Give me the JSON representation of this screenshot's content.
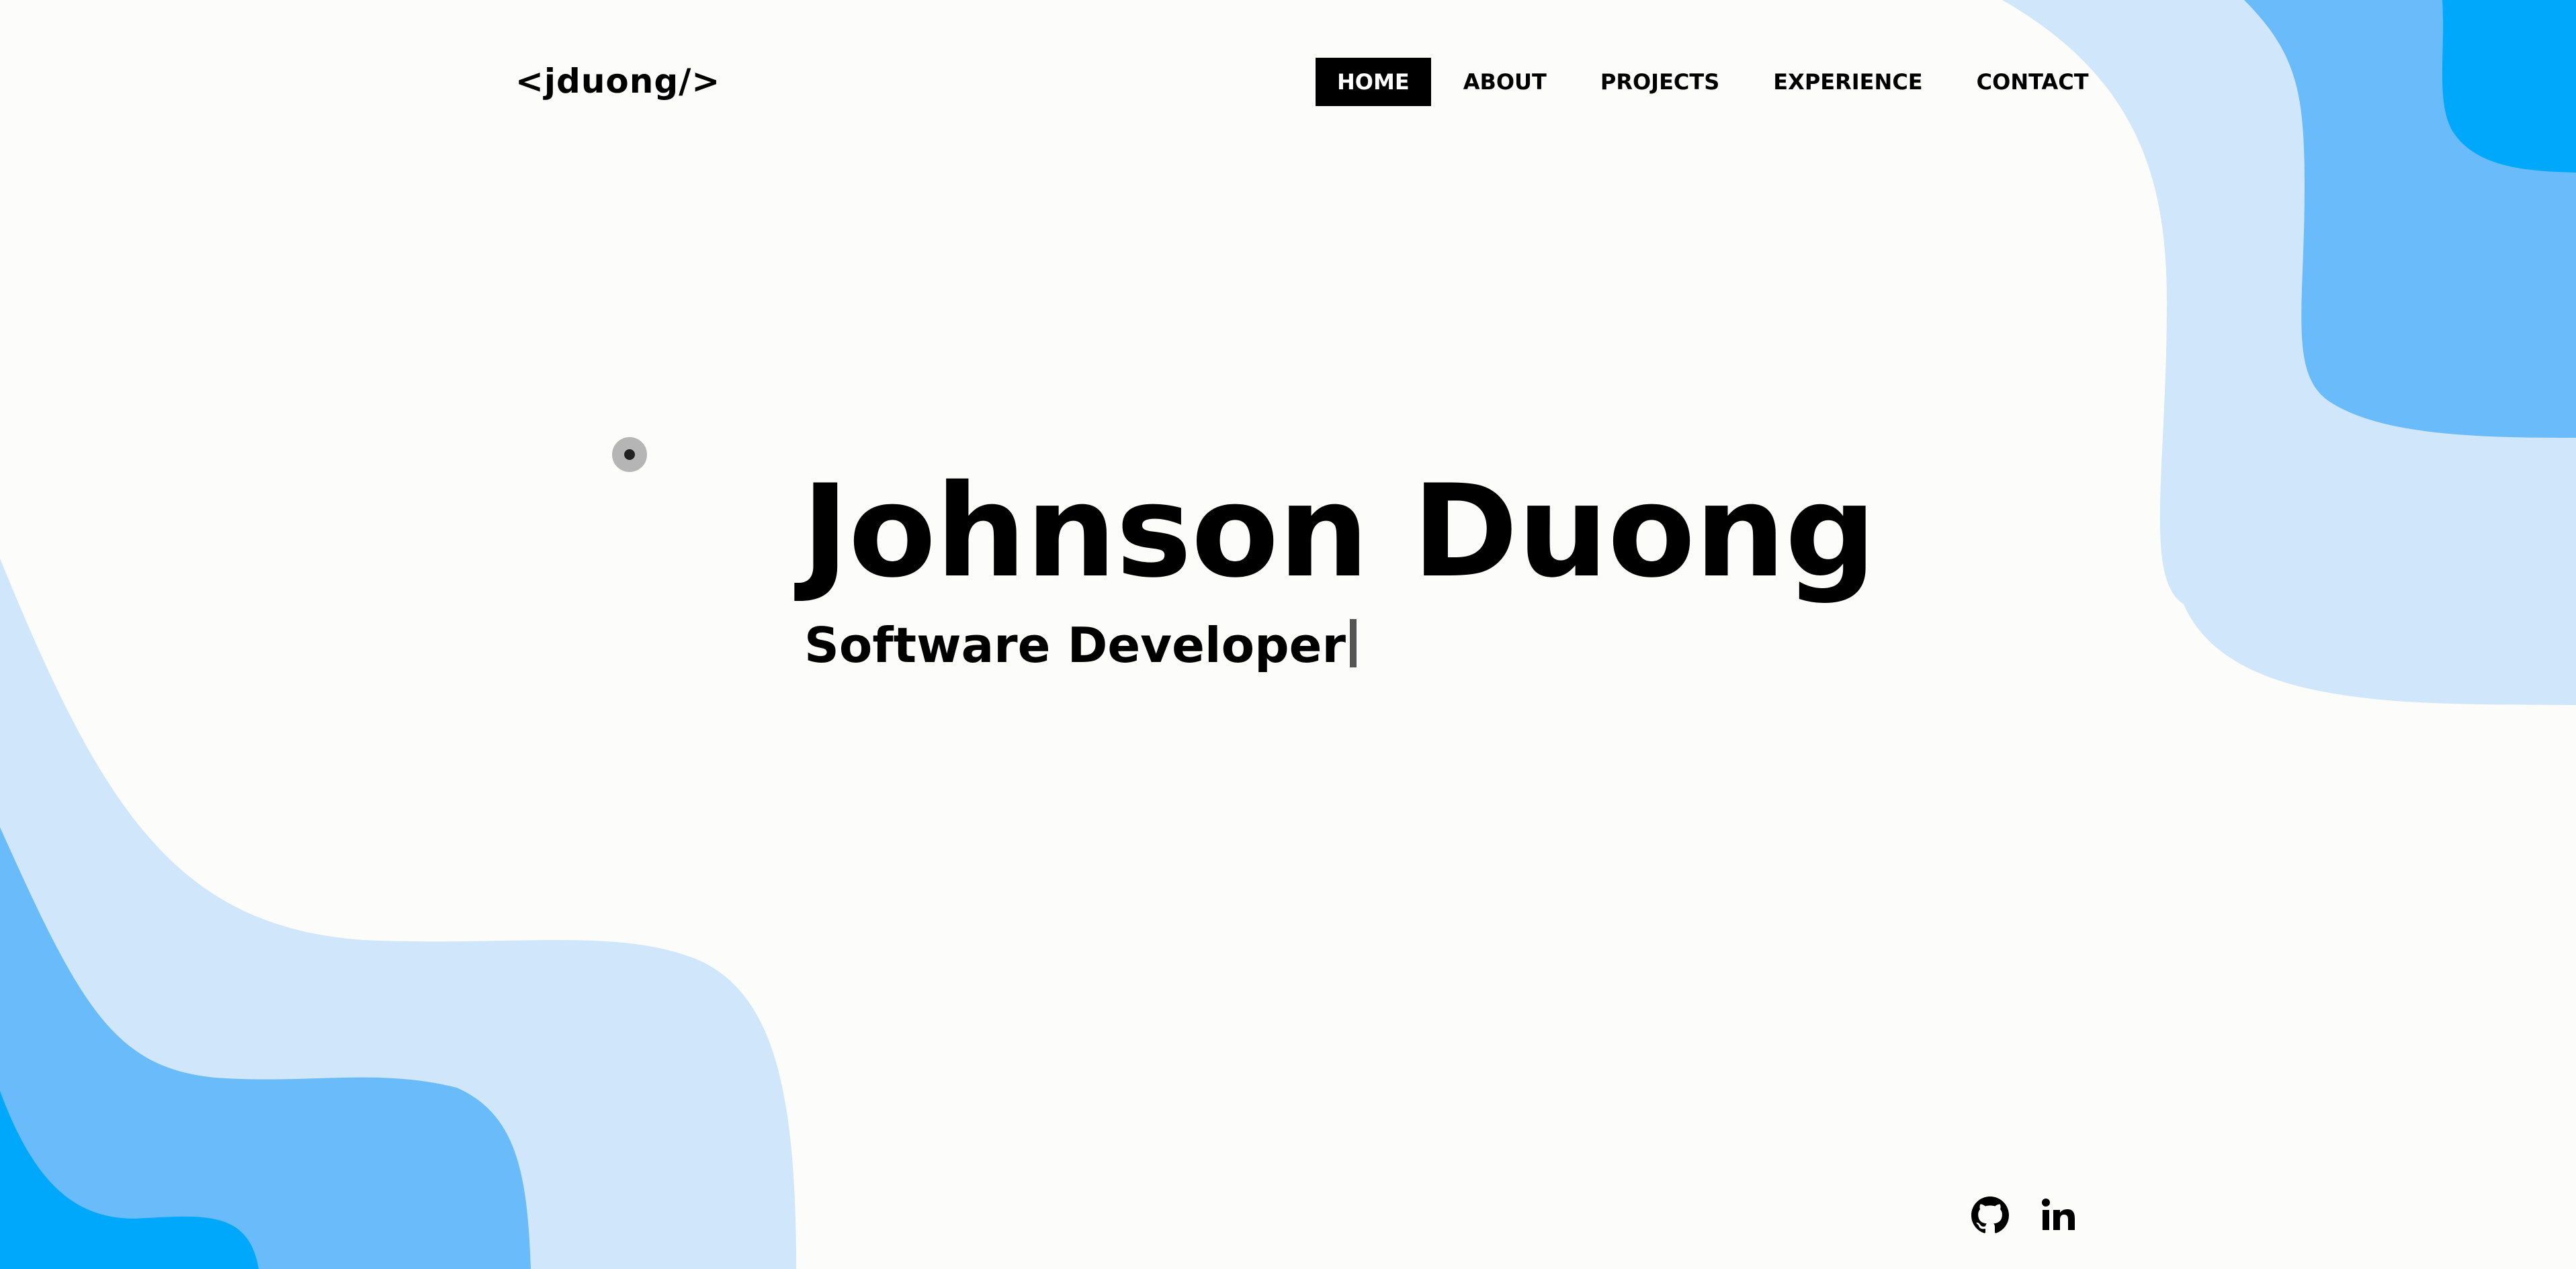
{
  "brand": {
    "logo_text": "<jduong/>"
  },
  "nav": {
    "items": [
      {
        "label": "HOME",
        "active": true
      },
      {
        "label": "ABOUT",
        "active": false
      },
      {
        "label": "PROJECTS",
        "active": false
      },
      {
        "label": "EXPERIENCE",
        "active": false
      },
      {
        "label": "CONTACT",
        "active": false
      }
    ]
  },
  "hero": {
    "name": "Johnson Duong",
    "role": "Software Developer"
  },
  "social": {
    "icons": [
      "github-icon",
      "linkedin-icon"
    ]
  },
  "colors": {
    "background": "#fcfcfb",
    "wave_light": "#d0e6fa",
    "wave_mid": "#6abbfa",
    "wave_dark": "#00a8fc",
    "nav_active_bg": "#000000",
    "nav_active_text": "#ffffff",
    "text": "#000000"
  }
}
